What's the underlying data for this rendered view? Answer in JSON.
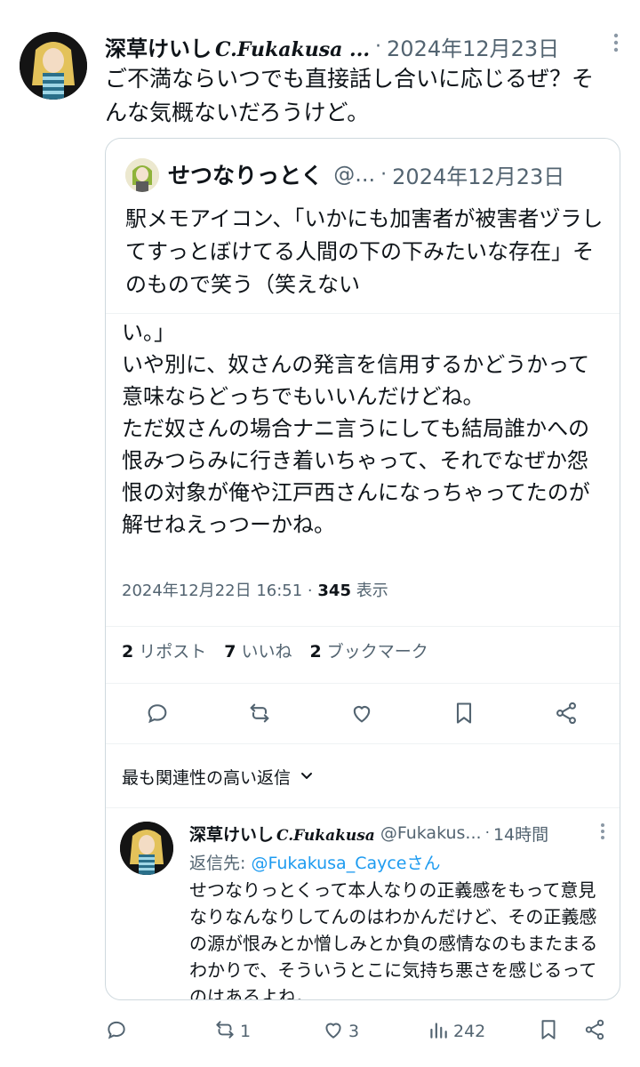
{
  "outer_tweet": {
    "name": "深草けいし",
    "name_suffix": "C.Fukakusa ...",
    "separator": "·",
    "date": "2024年12月23日",
    "text": "ご不満ならいつでも直接話し合いに応じるぜ？そんな気概ないだろうけど。"
  },
  "quoted_tweet": {
    "name": "せつなりっとく",
    "handle": "@...",
    "separator": "·",
    "date": "2024年12月23日",
    "text": "駅メモアイコン、「いかにも加害者が被害者ヅラしてすっとぼけてる人間の下の下みたいな存在」そのもので笑う（笑えない",
    "continuation": "い。」\nいや別に、奴さんの発言を信用するかどうかって意味ならどっちでもいいんだけどね。\nただ奴さんの場合ナニ言うにしても結局誰かへの恨みつらみに行き着いちゃって、それでなぜか怨恨の対象が俺や江戸西さんになっちゃってたのが解せねえっつーかね。",
    "timestamp": "2024年12月22日 16:51 · ",
    "views_count": "345",
    "views_label": " 表示",
    "stats": {
      "reposts_count": "2",
      "reposts_label": "リポスト",
      "likes_count": "7",
      "likes_label": "いいね",
      "bookmarks_count": "2",
      "bookmarks_label": "ブックマーク"
    },
    "sort_label": "最も関連性の高い返信"
  },
  "reply": {
    "name": "深草けいし",
    "name_suffix": "C.Fukakusa",
    "handle": "@Fukakus...",
    "separator": "·",
    "time": "14時間",
    "reply_prefix": "返信先: ",
    "reply_mention": "@Fukakusa_Cayceさん",
    "text": "せつなりっとくって本人なりの正義感をもって意見なりなんなりしてんのはわかんだけど、その正義感の源が恨みとか憎しみとか負の感情なのもまたまるわかりで、そういうとこに気持ち悪さを感じるってのはあるよね。"
  },
  "bottom_bar": {
    "retweets": "1",
    "likes": "3",
    "views": "242"
  },
  "colors": {
    "text": "#0f1419",
    "muted": "#536471",
    "border": "#cfd9de",
    "accent": "#1d9bf0"
  }
}
